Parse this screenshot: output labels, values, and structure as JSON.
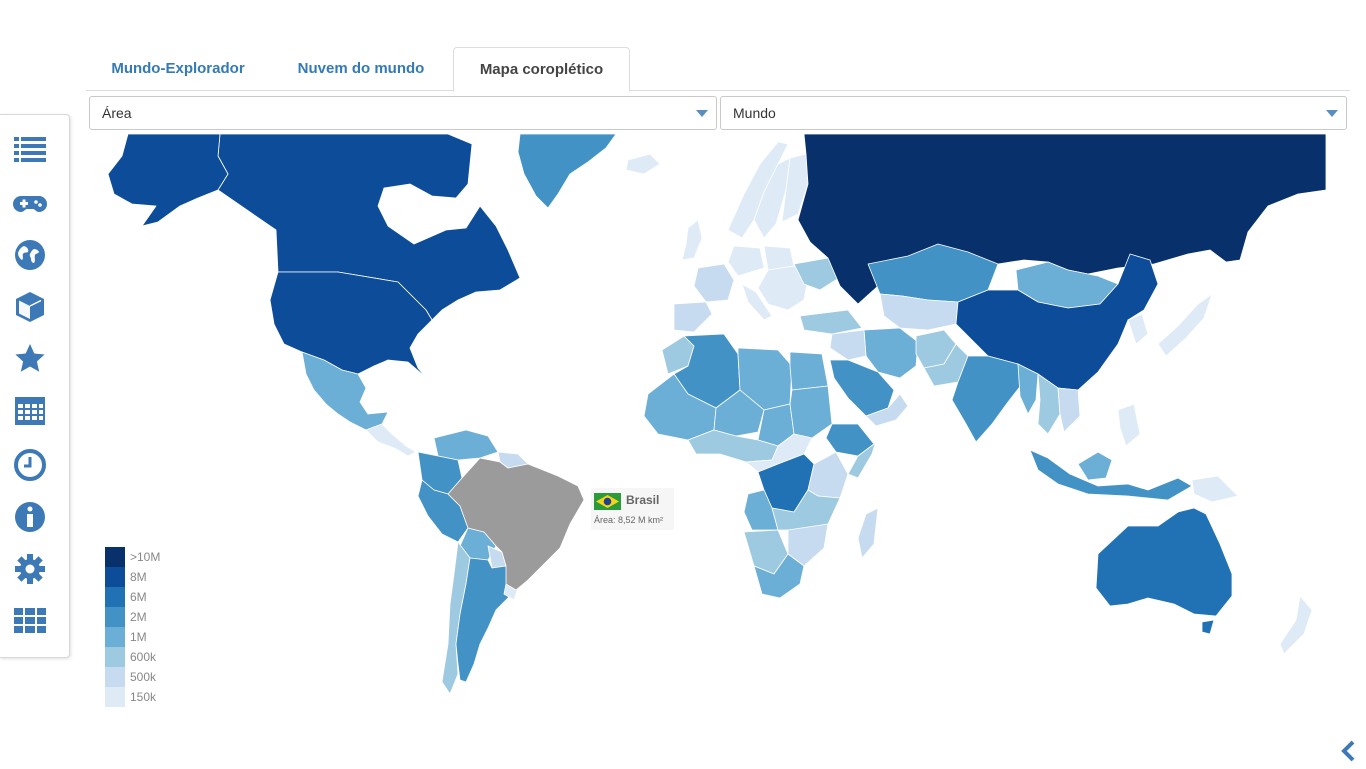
{
  "tabs": [
    {
      "label": "Mundo-Explorador",
      "active": false
    },
    {
      "label": "Nuvem do mundo",
      "active": false
    },
    {
      "label": "Mapa coroplético",
      "active": true
    }
  ],
  "filters": {
    "metric": {
      "selected": "Área"
    },
    "region": {
      "selected": "Mundo"
    }
  },
  "sidebar": {
    "items": [
      {
        "icon": "list-icon"
      },
      {
        "icon": "gamepad-icon"
      },
      {
        "icon": "globe-icon"
      },
      {
        "icon": "cube-icon"
      },
      {
        "icon": "star-icon"
      },
      {
        "icon": "calendar-icon"
      },
      {
        "icon": "clock-icon"
      },
      {
        "icon": "info-icon"
      },
      {
        "icon": "gear-icon"
      },
      {
        "icon": "grid-icon"
      }
    ],
    "color": "#3d79b6"
  },
  "legend": {
    "items": [
      {
        "label": ">10M",
        "color": "#08306b"
      },
      {
        "label": "8M",
        "color": "#0c4c99"
      },
      {
        "label": "6M",
        "color": "#2171b5"
      },
      {
        "label": "2M",
        "color": "#4292c6"
      },
      {
        "label": "1M",
        "color": "#6baed6"
      },
      {
        "label": "600k",
        "color": "#9ecae1"
      },
      {
        "label": "500k",
        "color": "#c6dbef"
      },
      {
        "label": "150k",
        "color": "#deebf7"
      }
    ]
  },
  "tooltip": {
    "country": "Brasil",
    "info": "Área: 8,52 M km²"
  },
  "highlight_color": "#9b9b9b",
  "collapse_icon": "chevron-left-icon"
}
